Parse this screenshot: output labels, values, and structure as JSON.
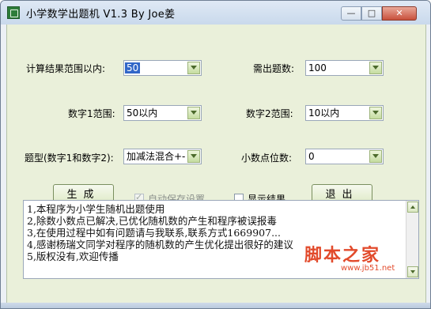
{
  "window": {
    "title": "小学数学出题机 V1.3 By Joe姜",
    "minimize_glyph": "—",
    "maximize_glyph": "□",
    "close_glyph": "✕"
  },
  "form": {
    "range_label": "计算结果范围以内:",
    "range_value": "50",
    "count_label": "需出题数:",
    "count_value": "100",
    "num1_label": "数字1范围:",
    "num1_value": "50以内",
    "num2_label": "数字2范围:",
    "num2_value": "10以内",
    "type_label": "题型(数字1和数字2):",
    "type_value": "加减法混合+-",
    "decimal_label": "小数点位数:",
    "decimal_value": "0"
  },
  "actions": {
    "generate_label": "生成",
    "exit_label": "退出",
    "autosave_label": "自动保存设置",
    "autosave_checked": true,
    "autosave_enabled": false,
    "show_result_label": "显示结果",
    "show_result_checked": false
  },
  "info": {
    "lines": [
      "1,本程序为小学生随机出题使用",
      "2,除数小数点已解决,已优化随机数的产生和程序被误报毒",
      "3,在使用过程中如有问题请与我联系,联系方式1669907...",
      "4,感谢杨瑞文同学对程序的随机数的产生优化提出很好的建议",
      "5,版权没有,欢迎传播"
    ]
  },
  "watermark": {
    "text": "脚本之家",
    "url": "www.jb51.net"
  },
  "icons": {
    "app": "app-icon",
    "dropdown": "chevron-down-icon"
  },
  "colors": {
    "client_bg": "#eaf0da",
    "selection": "#3166c8",
    "watermark": "#e24a2b"
  }
}
